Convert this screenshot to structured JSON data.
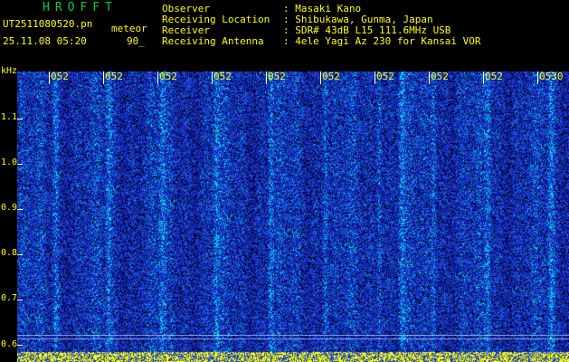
{
  "header": {
    "brand": "HROFFT",
    "filename": "UT2511080520.pn",
    "mode": "meteor",
    "datetime": "25.11.08 05:20",
    "count": "90_",
    "info": [
      {
        "label": "Observer",
        "value": ": Masaki Kano"
      },
      {
        "label": "Receiving Location",
        "value": ": Shibukawa, Gunma, Japan"
      },
      {
        "label": "Receiver",
        "value": ": SDR# 43dB L15 111.6MHz USB"
      },
      {
        "label": "Receiving Antenna",
        "value": ": 4ele Yagi Az 230 for Kansai VOR"
      }
    ]
  },
  "axis": {
    "unit": "kHz",
    "y_labels": [
      "1.1",
      "1.0",
      "0.9",
      "0.8",
      "0.7",
      "0.6"
    ],
    "x_labels": [
      "052",
      "052",
      "052",
      "052",
      "052",
      "052",
      "052",
      "052",
      "052",
      "0530"
    ]
  },
  "colors": {
    "text": "#ffff00",
    "brand": "#00cc44",
    "background": "#000000",
    "spectrogram_base": "#1a2fb8",
    "spectrogram_hot": "#00ffff",
    "bottom_strip": "#ffff00"
  }
}
